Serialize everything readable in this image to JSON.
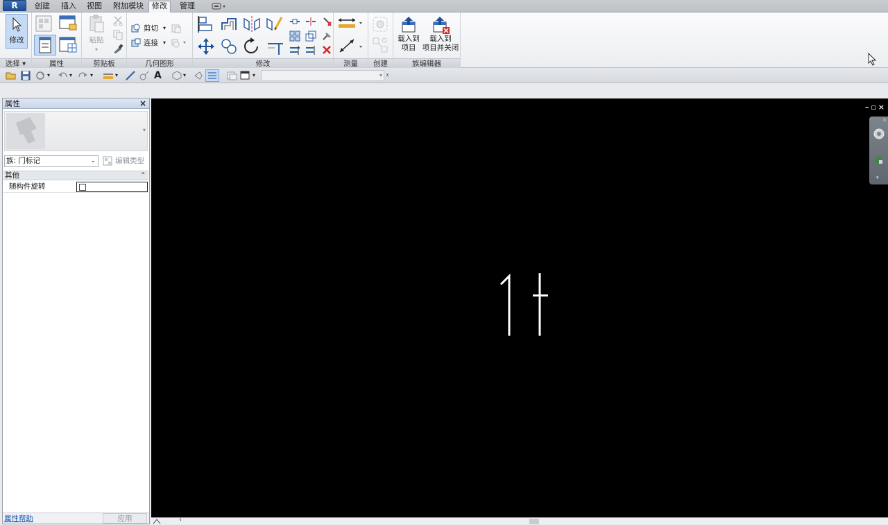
{
  "tabs": [
    {
      "label": "创建",
      "active": false
    },
    {
      "label": "插入",
      "active": false
    },
    {
      "label": "视图",
      "active": false
    },
    {
      "label": "附加模块",
      "active": false
    },
    {
      "label": "修改",
      "active": true
    },
    {
      "label": "管理",
      "active": false
    }
  ],
  "ribbon": {
    "select_panel": {
      "button": "修改",
      "label": "选择 ▾"
    },
    "properties_panel": {
      "label": "属性"
    },
    "clipboard_panel": {
      "paste": "粘贴",
      "label": "剪贴板"
    },
    "geometry_panel": {
      "cut": "剪切",
      "join": "连接",
      "label": "几何图形"
    },
    "modify_panel": {
      "label": "修改"
    },
    "measure_panel": {
      "label": "测量"
    },
    "create_panel": {
      "label": "创建"
    },
    "family_editor_panel": {
      "load_project": "载入到\n项目",
      "load_project_line1": "载入到",
      "load_project_line2": "项目",
      "load_close_line1": "载入到",
      "load_close_line2": "项目并关闭",
      "label": "族编辑器"
    }
  },
  "properties": {
    "title": "属性",
    "close": "×",
    "family_select": "族: 门标记",
    "edit_type": "编辑类型",
    "group": "其他",
    "parameters": [
      {
        "label": "随构件旋转",
        "checked": false
      }
    ],
    "help_link": "属性帮助",
    "apply": "应用"
  },
  "canvas": {
    "tag_text": "1",
    "window_controls": "– ▫ ×",
    "background": "#000000"
  },
  "colors": {
    "accent": "#1d4f96",
    "active_button": "#c5dbf5"
  }
}
